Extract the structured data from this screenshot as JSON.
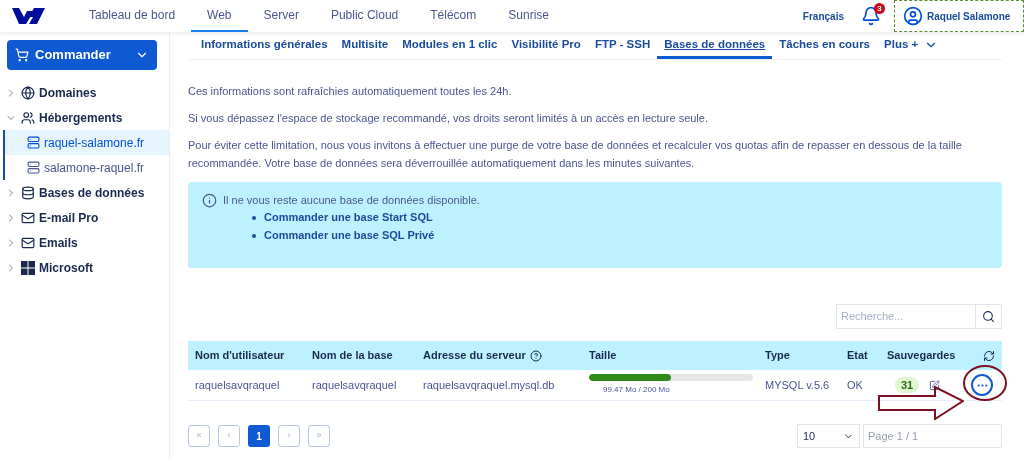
{
  "top_nav": [
    {
      "label": "Tableau de bord",
      "selected": false
    },
    {
      "label": "Web",
      "selected": true
    },
    {
      "label": "Server",
      "selected": false
    },
    {
      "label": "Public Cloud",
      "selected": false
    },
    {
      "label": "Télécom",
      "selected": false
    },
    {
      "label": "Sunrise",
      "selected": false
    }
  ],
  "language": "Français",
  "notifications": {
    "count": "3"
  },
  "user": {
    "name": "Raquel Salamone"
  },
  "order_button": {
    "label": "Commander"
  },
  "sidebar": {
    "items": [
      {
        "label": "Domaines",
        "expanded": false
      },
      {
        "label": "Hébergements",
        "expanded": true,
        "children": [
          {
            "label": "raquel-salamone.fr",
            "selected": true
          },
          {
            "label": "salamone-raquel.fr",
            "selected": false
          }
        ]
      },
      {
        "label": "Bases de données",
        "expanded": false
      },
      {
        "label": "E-mail Pro",
        "expanded": false
      },
      {
        "label": "Emails",
        "expanded": false
      },
      {
        "label": "Microsoft",
        "expanded": false
      }
    ]
  },
  "tabs": [
    {
      "label": "Informations générales",
      "selected": false
    },
    {
      "label": "Multisite",
      "selected": false
    },
    {
      "label": "Modules en 1 clic",
      "selected": false
    },
    {
      "label": "Visibilité Pro",
      "selected": false
    },
    {
      "label": "FTP - SSH",
      "selected": false
    },
    {
      "label": "Bases de données",
      "selected": true
    },
    {
      "label": "Tâches en cours",
      "selected": false
    },
    {
      "label": "Plus +",
      "selected": false
    }
  ],
  "paragraphs": [
    "Ces informations sont rafraîchies automatiquement toutes les 24h.",
    "Si vous dépassez l'espace de stockage recommandé, vos droits seront limités à un accès en lecture seule.",
    "Pour éviter cette limitation, nous vous invitons à effectuer une purge de votre base de données et recalculer vos quotas afin de repasser en dessous de la taille recommandée. Votre base de données sera déverrouillée automatiquement dans les minutes suivantes."
  ],
  "info_box": {
    "message": "Il ne vous reste aucune base de données disponible.",
    "links": [
      "Commander une base Start SQL",
      "Commander une base SQL Privé"
    ]
  },
  "search": {
    "placeholder": "Recherche..."
  },
  "table": {
    "columns": [
      "Nom d'utilisateur",
      "Nom de la base",
      "Adresse du serveur",
      "Taille",
      "Type",
      "Etat",
      "Sauvegardes"
    ],
    "rows": [
      {
        "user": "raquelsavqraquel",
        "database": "raquelsavqraquel",
        "server": "raquelsavqraquel.mysql.db",
        "level": 0.4974,
        "size": "99.47 Mo / 200 Mo",
        "type": "MYSQL v.5.6",
        "state": "OK",
        "backups": "31"
      }
    ]
  },
  "pagination": {
    "first": "«",
    "prev": "‹",
    "pages": [
      {
        "label": "1",
        "selected": true
      }
    ],
    "next": "›",
    "last": "»"
  },
  "page_size": "10",
  "page_info": "Page 1 / 1"
}
